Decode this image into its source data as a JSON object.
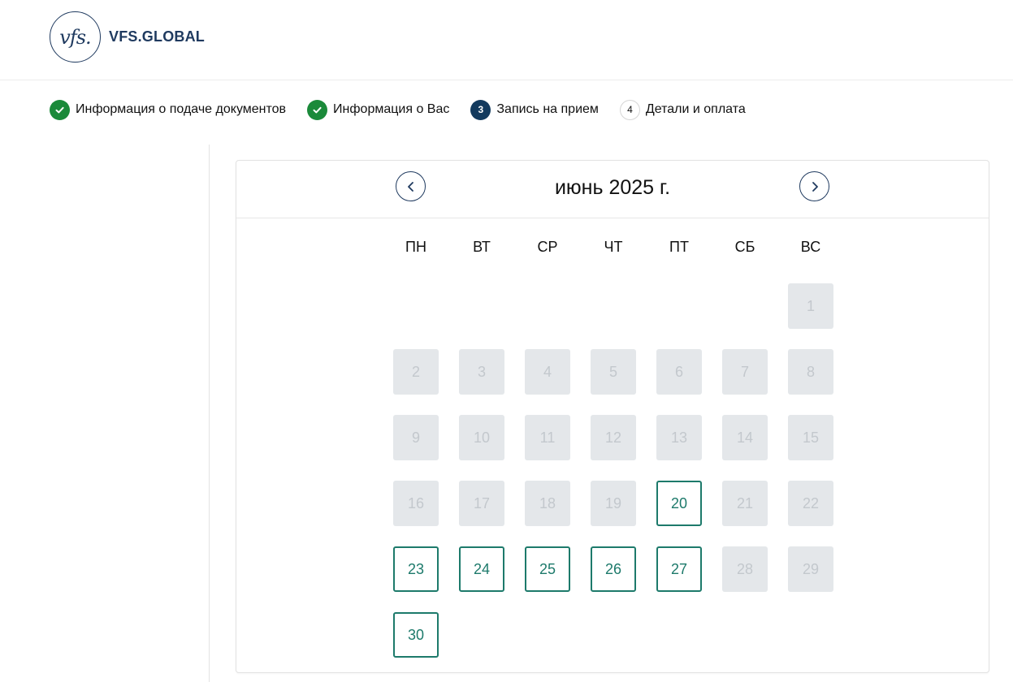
{
  "header": {
    "logo_mark": "vfs.",
    "logo_text": "VFS.GLOBAL"
  },
  "stepper": [
    {
      "label": "Информация о подаче документов",
      "status": "done",
      "number": "1",
      "icon": "check-circle-icon"
    },
    {
      "label": "Информация о Вас",
      "status": "done",
      "number": "2",
      "icon": "check-circle-icon"
    },
    {
      "label": "Запись на прием",
      "status": "current",
      "number": "3",
      "icon": ""
    },
    {
      "label": "Детали и оплата",
      "status": "todo",
      "number": "4",
      "icon": ""
    }
  ],
  "calendar": {
    "month_title": "июнь 2025 г.",
    "prev_icon": "chevron-left-icon",
    "next_icon": "chevron-right-icon",
    "weekdays": [
      "ПН",
      "ВТ",
      "СР",
      "ЧТ",
      "ПТ",
      "СБ",
      "ВС"
    ],
    "first_weekday_index": 6,
    "days": [
      {
        "day": "1",
        "available": false
      },
      {
        "day": "2",
        "available": false
      },
      {
        "day": "3",
        "available": false
      },
      {
        "day": "4",
        "available": false
      },
      {
        "day": "5",
        "available": false
      },
      {
        "day": "6",
        "available": false
      },
      {
        "day": "7",
        "available": false
      },
      {
        "day": "8",
        "available": false
      },
      {
        "day": "9",
        "available": false
      },
      {
        "day": "10",
        "available": false
      },
      {
        "day": "11",
        "available": false
      },
      {
        "day": "12",
        "available": false
      },
      {
        "day": "13",
        "available": false
      },
      {
        "day": "14",
        "available": false
      },
      {
        "day": "15",
        "available": false
      },
      {
        "day": "16",
        "available": false
      },
      {
        "day": "17",
        "available": false
      },
      {
        "day": "18",
        "available": false
      },
      {
        "day": "19",
        "available": false
      },
      {
        "day": "20",
        "available": true
      },
      {
        "day": "21",
        "available": false
      },
      {
        "day": "22",
        "available": false
      },
      {
        "day": "23",
        "available": true
      },
      {
        "day": "24",
        "available": true
      },
      {
        "day": "25",
        "available": true
      },
      {
        "day": "26",
        "available": true
      },
      {
        "day": "27",
        "available": true
      },
      {
        "day": "28",
        "available": false
      },
      {
        "day": "29",
        "available": false
      },
      {
        "day": "30",
        "available": true
      }
    ]
  },
  "colors": {
    "brand": "#1f3a5f",
    "step_done": "#1b8a3a",
    "step_current": "#133a5e",
    "available": "#1d7a6b",
    "disabled_bg": "#e4e7ea",
    "disabled_text": "#c3c8cd"
  }
}
